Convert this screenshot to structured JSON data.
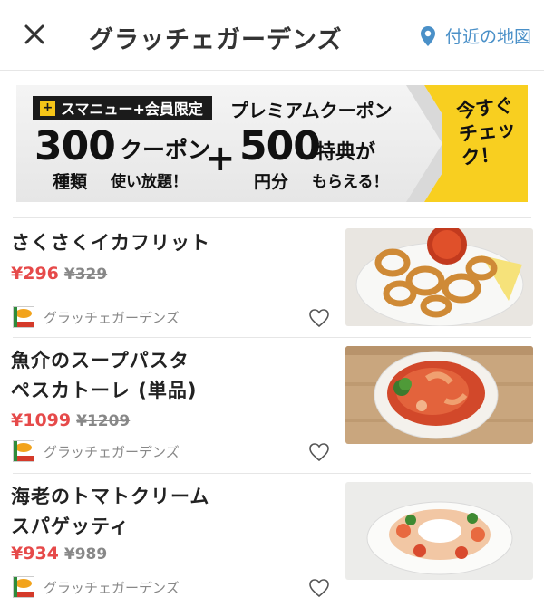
{
  "header": {
    "title": "グラッチェガーデンズ",
    "map_label": "付近の地図"
  },
  "banner": {
    "tag": "スマニュー+会員限定",
    "tag_plus": "+",
    "premium": "プレミアムクーポン",
    "num1": "300",
    "num1_unit": "種類",
    "coupon": "クーポン",
    "coupon_sub": "使い放題！",
    "plus": "+",
    "num2": "500",
    "num2_unit": "円分",
    "tokuten": "特典が",
    "tokuten_sub": "もらえる！",
    "cta_line1": "今すぐ",
    "cta_line2": "チェック！"
  },
  "items": [
    {
      "name_line1": "さくさくイカフリット",
      "name_line2": "",
      "sale_price": "¥296",
      "orig_price": "¥329",
      "shop": "グラッチェガーデンズ"
    },
    {
      "name_line1": "魚介のスープパスタ",
      "name_line2": "ペスカトーレ (単品)",
      "sale_price": "¥1099",
      "orig_price": "¥1209",
      "shop": "グラッチェガーデンズ"
    },
    {
      "name_line1": "海老のトマトクリーム",
      "name_line2": "スパゲッティ",
      "sale_price": "¥934",
      "orig_price": "¥989",
      "shop": "グラッチェガーデンズ"
    }
  ],
  "colors": {
    "accent_blue": "#4a90c8",
    "sale_red": "#e64a4a",
    "banner_yellow": "#f8cf20"
  }
}
